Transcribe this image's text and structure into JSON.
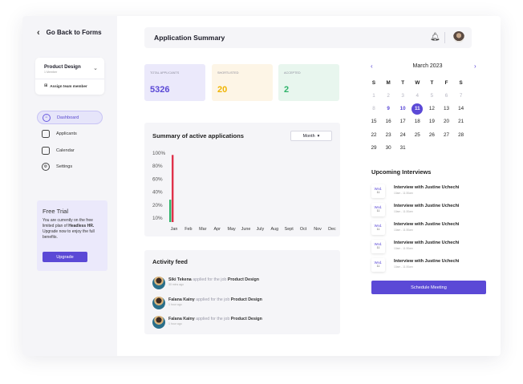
{
  "sidebar": {
    "back_label": "Go Back to Forms",
    "team": {
      "name": "Product Design",
      "sub": "1 Member",
      "assign_label": "Assign team member"
    },
    "nav": [
      {
        "label": "Dashboard",
        "icon": "home-icon",
        "active": true
      },
      {
        "label": "Applicants",
        "icon": "briefcase-icon",
        "active": false
      },
      {
        "label": "Calendar",
        "icon": "calendar-icon",
        "active": false
      },
      {
        "label": "Settings",
        "icon": "gear-icon",
        "active": false
      }
    ],
    "trial": {
      "title": "Free Trial",
      "text_before": "You are currently on the free limited plan of ",
      "brand": "Headless HR.",
      "text_after": " Upgrade now to enjoy the full benefits.",
      "button": "Upgrade"
    }
  },
  "header": {
    "title": "Application Summary",
    "notification_icon": "bell-icon"
  },
  "stats": [
    {
      "label": "Total Applicants",
      "value": "5326",
      "color": "#5b49d6",
      "bg": "#ebe9fb"
    },
    {
      "label": "Shortlisted",
      "value": "20",
      "color": "#f0b400",
      "bg": "#fdf5e6"
    },
    {
      "label": "Accepted",
      "value": "2",
      "color": "#2fb36a",
      "bg": "#e8f6ee"
    }
  ],
  "summary": {
    "title": "Summary of active  applications",
    "filter": "Month"
  },
  "chart_data": {
    "type": "bar",
    "title": "Summary of active  applications",
    "categories": [
      "Jan",
      "Feb",
      "Mar",
      "Apr",
      "May",
      "June",
      "July",
      "Aug",
      "Sept",
      "Oct",
      "Nov",
      "Dec"
    ],
    "y_ticks": [
      "100%",
      "80%",
      "60%",
      "40%",
      "20%",
      "10%"
    ],
    "ylim": [
      0,
      100
    ],
    "y_labels_spacing": "uniform",
    "series": [
      {
        "values": [
          30,
          null,
          null,
          null,
          null,
          null,
          null,
          null,
          null,
          null,
          null,
          null
        ],
        "color": "#2fb36a"
      },
      {
        "values": [
          90,
          null,
          null,
          null,
          null,
          null,
          null,
          null,
          null,
          null,
          null,
          null
        ],
        "color": "#e0314a"
      }
    ],
    "grid": false,
    "legend": "none"
  },
  "activity": {
    "title": "Activity feed",
    "items": [
      {
        "name": "Siki Tekena",
        "action": " applied for the job ",
        "job": "Product Design",
        "time": "30 mins ago"
      },
      {
        "name": "Falana Kainy",
        "action": " applied for the job ",
        "job": "Product Design",
        "time": "1 hour ago"
      },
      {
        "name": "Falana Kainy",
        "action": " applied for the job ",
        "job": "Product Design",
        "time": "1 hour ago"
      }
    ]
  },
  "calendar": {
    "title": "March 2023",
    "prev": "‹",
    "next": "›",
    "days_of_week": [
      "S",
      "M",
      "T",
      "W",
      "T",
      "F",
      "S"
    ],
    "weeks": [
      [
        "1",
        "2",
        "3",
        "4",
        "5",
        "6",
        "7"
      ],
      [
        "8",
        "9",
        "10",
        "11",
        "12",
        "13",
        "14"
      ],
      [
        "15",
        "16",
        "17",
        "18",
        "19",
        "20",
        "21"
      ],
      [
        "22",
        "23",
        "24",
        "25",
        "26",
        "27",
        "28"
      ],
      [
        "29",
        "30",
        "31",
        "",
        "",
        "",
        ""
      ]
    ],
    "muted": [
      "1",
      "2",
      "3",
      "4",
      "5",
      "6",
      "7",
      "8"
    ],
    "highlighted": [
      "9",
      "10"
    ],
    "selected": "11"
  },
  "interviews": {
    "title": "Upcoming Interviews",
    "items": [
      {
        "dow": "Wed.",
        "day": "11",
        "title": "Interview with Justine Uchechi",
        "time": "10am - 11:30am"
      },
      {
        "dow": "Wed.",
        "day": "11",
        "title": "Interview with Justine Uchechi",
        "time": "10am - 11:30am"
      },
      {
        "dow": "Wed.",
        "day": "11",
        "title": "Interview with Justine Uchechi",
        "time": "10am - 11:30am"
      },
      {
        "dow": "Wed.",
        "day": "11",
        "title": "Interview with Justine Uchechi",
        "time": "10am - 11:30am"
      },
      {
        "dow": "Wed.",
        "day": "11",
        "title": "Interview with Justine Uchechi",
        "time": "10am - 11:30am"
      }
    ],
    "button": "Schedule Meeting"
  }
}
